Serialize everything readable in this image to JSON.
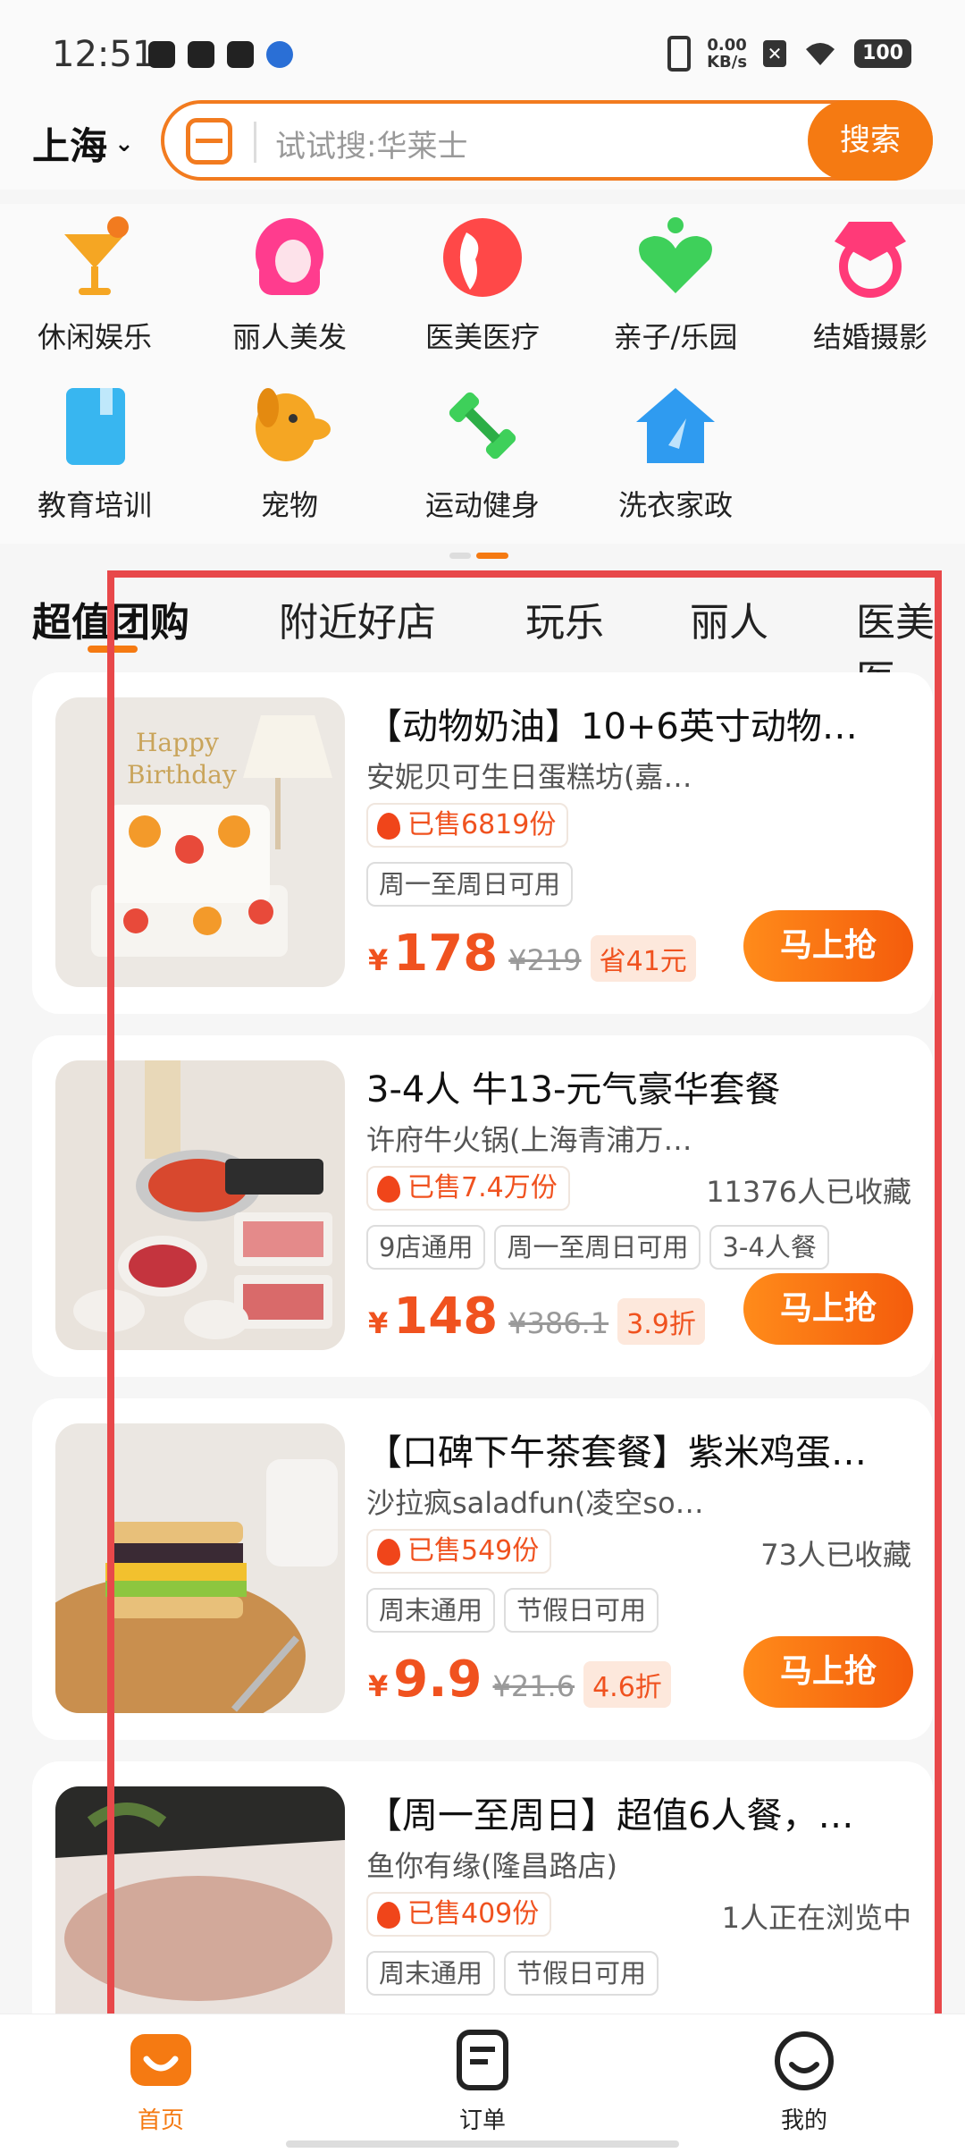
{
  "status_bar": {
    "time": "12:51",
    "net_speed_top": "0.00",
    "net_speed_unit": "KB/s",
    "battery": "100"
  },
  "header": {
    "city": "上海",
    "search_placeholder": "试试搜:华莱士",
    "search_button": "搜索"
  },
  "categories": [
    {
      "label": "休闲娱乐",
      "icon": "cocktail-icon",
      "color": "#f5a623"
    },
    {
      "label": "丽人美发",
      "icon": "hair-icon",
      "color": "#ff3c8e"
    },
    {
      "label": "医美医疗",
      "icon": "face-icon",
      "color": "#ff4848"
    },
    {
      "label": "亲子/乐园",
      "icon": "heart-icon",
      "color": "#3ed05a"
    },
    {
      "label": "结婚摄影",
      "icon": "ring-icon",
      "color": "#ff3a78"
    },
    {
      "label": "教育培训",
      "icon": "book-icon",
      "color": "#38b6f0"
    },
    {
      "label": "宠物",
      "icon": "dog-icon",
      "color": "#f5a623"
    },
    {
      "label": "运动健身",
      "icon": "dumbbell-icon",
      "color": "#3ed05a"
    },
    {
      "label": "洗衣家政",
      "icon": "house-icon",
      "color": "#2f9bf0"
    }
  ],
  "tabs": [
    "超值团购",
    "附近好店",
    "玩乐",
    "丽人",
    "医美医"
  ],
  "deals": [
    {
      "title": "【动物奶油】10+6英寸动物…",
      "shop": "安妮贝可生日蛋糕坊(嘉…",
      "sold": "已售6819份",
      "favorites": "",
      "tags": [
        "周一至周日可用"
      ],
      "price": "178",
      "original": "¥219",
      "discount": "省41元",
      "buy": "马上抢"
    },
    {
      "title": "3-4人 牛13-元气豪华套餐",
      "shop": "许府牛火锅(上海青浦万…",
      "sold": "已售7.4万份",
      "favorites": "11376人已收藏",
      "tags": [
        "9店通用",
        "周一至周日可用",
        "3-4人餐"
      ],
      "price": "148",
      "original": "¥386.1",
      "discount": "3.9折",
      "buy": "马上抢"
    },
    {
      "title": "【口碑下午茶套餐】紫米鸡蛋…",
      "shop": "沙拉疯saladfun(凌空so…",
      "sold": "已售549份",
      "favorites": "73人已收藏",
      "tags": [
        "周末通用",
        "节假日可用"
      ],
      "price": "9.9",
      "original": "¥21.6",
      "discount": "4.6折",
      "buy": "马上抢"
    },
    {
      "title": "【周一至周日】超值6人餐，…",
      "shop": "鱼你有缘(隆昌路店)",
      "sold": "已售409份",
      "favorites": "1人正在浏览中",
      "tags": [
        "周末通用",
        "节假日可用"
      ],
      "price": "",
      "original": "",
      "discount": "",
      "buy": ""
    }
  ],
  "currency": "¥",
  "bottom_nav": [
    {
      "label": "首页",
      "icon": "home-icon",
      "active": true
    },
    {
      "label": "订单",
      "icon": "order-icon",
      "active": false
    },
    {
      "label": "我的",
      "icon": "profile-icon",
      "active": false
    }
  ],
  "colors": {
    "accent": "#f57a12",
    "price": "#f0521f",
    "highlight_box": "#e8484a"
  }
}
